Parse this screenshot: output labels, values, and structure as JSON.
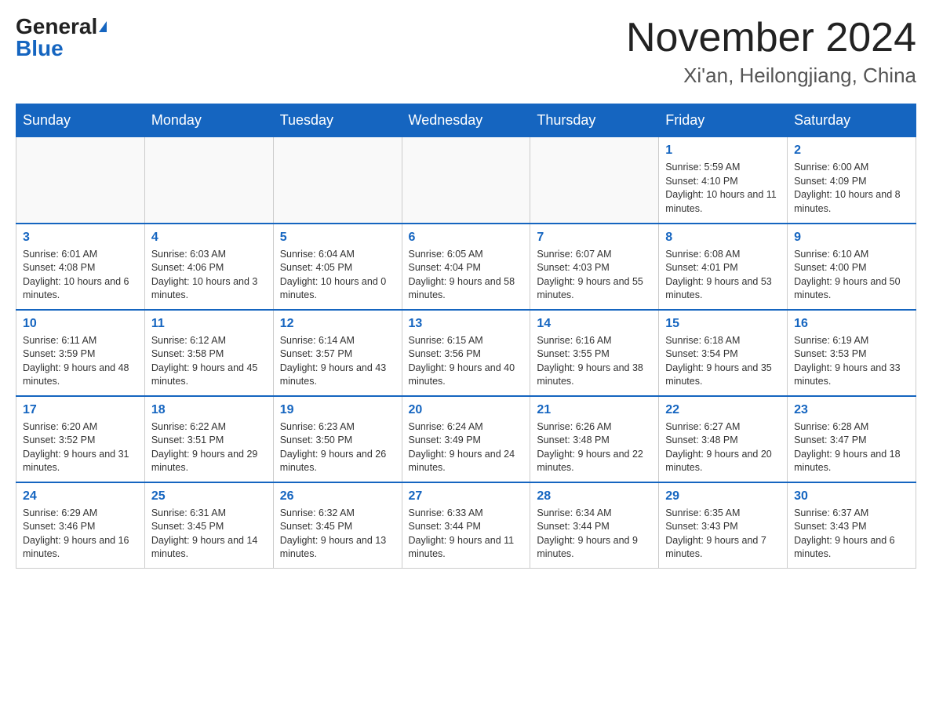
{
  "header": {
    "logo_general": "General",
    "logo_blue": "Blue",
    "month_year": "November 2024",
    "location": "Xi'an, Heilongjiang, China"
  },
  "weekdays": [
    "Sunday",
    "Monday",
    "Tuesday",
    "Wednesday",
    "Thursday",
    "Friday",
    "Saturday"
  ],
  "weeks": [
    [
      {
        "day": "",
        "info": ""
      },
      {
        "day": "",
        "info": ""
      },
      {
        "day": "",
        "info": ""
      },
      {
        "day": "",
        "info": ""
      },
      {
        "day": "",
        "info": ""
      },
      {
        "day": "1",
        "info": "Sunrise: 5:59 AM\nSunset: 4:10 PM\nDaylight: 10 hours and 11 minutes."
      },
      {
        "day": "2",
        "info": "Sunrise: 6:00 AM\nSunset: 4:09 PM\nDaylight: 10 hours and 8 minutes."
      }
    ],
    [
      {
        "day": "3",
        "info": "Sunrise: 6:01 AM\nSunset: 4:08 PM\nDaylight: 10 hours and 6 minutes."
      },
      {
        "day": "4",
        "info": "Sunrise: 6:03 AM\nSunset: 4:06 PM\nDaylight: 10 hours and 3 minutes."
      },
      {
        "day": "5",
        "info": "Sunrise: 6:04 AM\nSunset: 4:05 PM\nDaylight: 10 hours and 0 minutes."
      },
      {
        "day": "6",
        "info": "Sunrise: 6:05 AM\nSunset: 4:04 PM\nDaylight: 9 hours and 58 minutes."
      },
      {
        "day": "7",
        "info": "Sunrise: 6:07 AM\nSunset: 4:03 PM\nDaylight: 9 hours and 55 minutes."
      },
      {
        "day": "8",
        "info": "Sunrise: 6:08 AM\nSunset: 4:01 PM\nDaylight: 9 hours and 53 minutes."
      },
      {
        "day": "9",
        "info": "Sunrise: 6:10 AM\nSunset: 4:00 PM\nDaylight: 9 hours and 50 minutes."
      }
    ],
    [
      {
        "day": "10",
        "info": "Sunrise: 6:11 AM\nSunset: 3:59 PM\nDaylight: 9 hours and 48 minutes."
      },
      {
        "day": "11",
        "info": "Sunrise: 6:12 AM\nSunset: 3:58 PM\nDaylight: 9 hours and 45 minutes."
      },
      {
        "day": "12",
        "info": "Sunrise: 6:14 AM\nSunset: 3:57 PM\nDaylight: 9 hours and 43 minutes."
      },
      {
        "day": "13",
        "info": "Sunrise: 6:15 AM\nSunset: 3:56 PM\nDaylight: 9 hours and 40 minutes."
      },
      {
        "day": "14",
        "info": "Sunrise: 6:16 AM\nSunset: 3:55 PM\nDaylight: 9 hours and 38 minutes."
      },
      {
        "day": "15",
        "info": "Sunrise: 6:18 AM\nSunset: 3:54 PM\nDaylight: 9 hours and 35 minutes."
      },
      {
        "day": "16",
        "info": "Sunrise: 6:19 AM\nSunset: 3:53 PM\nDaylight: 9 hours and 33 minutes."
      }
    ],
    [
      {
        "day": "17",
        "info": "Sunrise: 6:20 AM\nSunset: 3:52 PM\nDaylight: 9 hours and 31 minutes."
      },
      {
        "day": "18",
        "info": "Sunrise: 6:22 AM\nSunset: 3:51 PM\nDaylight: 9 hours and 29 minutes."
      },
      {
        "day": "19",
        "info": "Sunrise: 6:23 AM\nSunset: 3:50 PM\nDaylight: 9 hours and 26 minutes."
      },
      {
        "day": "20",
        "info": "Sunrise: 6:24 AM\nSunset: 3:49 PM\nDaylight: 9 hours and 24 minutes."
      },
      {
        "day": "21",
        "info": "Sunrise: 6:26 AM\nSunset: 3:48 PM\nDaylight: 9 hours and 22 minutes."
      },
      {
        "day": "22",
        "info": "Sunrise: 6:27 AM\nSunset: 3:48 PM\nDaylight: 9 hours and 20 minutes."
      },
      {
        "day": "23",
        "info": "Sunrise: 6:28 AM\nSunset: 3:47 PM\nDaylight: 9 hours and 18 minutes."
      }
    ],
    [
      {
        "day": "24",
        "info": "Sunrise: 6:29 AM\nSunset: 3:46 PM\nDaylight: 9 hours and 16 minutes."
      },
      {
        "day": "25",
        "info": "Sunrise: 6:31 AM\nSunset: 3:45 PM\nDaylight: 9 hours and 14 minutes."
      },
      {
        "day": "26",
        "info": "Sunrise: 6:32 AM\nSunset: 3:45 PM\nDaylight: 9 hours and 13 minutes."
      },
      {
        "day": "27",
        "info": "Sunrise: 6:33 AM\nSunset: 3:44 PM\nDaylight: 9 hours and 11 minutes."
      },
      {
        "day": "28",
        "info": "Sunrise: 6:34 AM\nSunset: 3:44 PM\nDaylight: 9 hours and 9 minutes."
      },
      {
        "day": "29",
        "info": "Sunrise: 6:35 AM\nSunset: 3:43 PM\nDaylight: 9 hours and 7 minutes."
      },
      {
        "day": "30",
        "info": "Sunrise: 6:37 AM\nSunset: 3:43 PM\nDaylight: 9 hours and 6 minutes."
      }
    ]
  ]
}
